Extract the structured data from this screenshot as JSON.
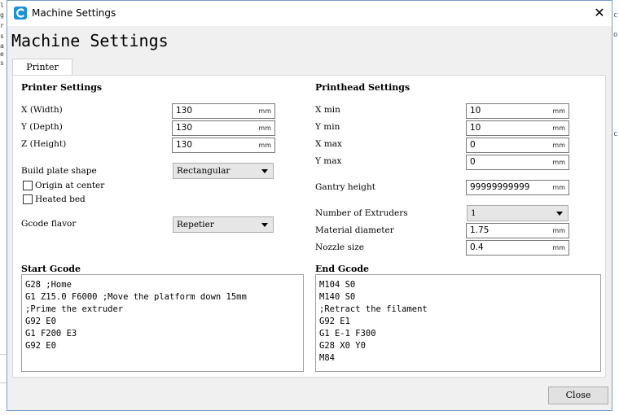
{
  "background": {
    "left_fragments": [
      "l",
      "g",
      "r",
      "s",
      "a",
      "e",
      "s"
    ],
    "right_fragments": [
      "c",
      "o",
      "c"
    ]
  },
  "window": {
    "title": "Machine Settings",
    "close_glyph": "✕",
    "heading": "Machine Settings",
    "tab": "Printer"
  },
  "printer_settings": {
    "header": "Printer Settings",
    "fields": [
      {
        "label": "X (Width)",
        "value": "130",
        "unit": "mm"
      },
      {
        "label": "Y (Depth)",
        "value": "130",
        "unit": "mm"
      },
      {
        "label": "Z (Height)",
        "value": "130",
        "unit": "mm"
      }
    ],
    "build_plate_label": "Build plate shape",
    "build_plate_value": "Rectangular",
    "origin_label": "Origin at center",
    "heated_label": "Heated bed",
    "gcode_flavor_label": "Gcode flavor",
    "gcode_flavor_value": "Repetier"
  },
  "printhead_settings": {
    "header": "Printhead Settings",
    "fields": [
      {
        "label": "X min",
        "value": "10",
        "unit": "mm"
      },
      {
        "label": "Y min",
        "value": "10",
        "unit": "mm"
      },
      {
        "label": "X max",
        "value": "0",
        "unit": "mm"
      },
      {
        "label": "Y max",
        "value": "0",
        "unit": "mm"
      }
    ],
    "gantry_label": "Gantry height",
    "gantry_value": "99999999999",
    "gantry_unit": "mm",
    "extruders_label": "Number of Extruders",
    "extruders_value": "1",
    "material_label": "Material diameter",
    "material_value": "1.75",
    "material_unit": "mm",
    "nozzle_label": "Nozzle size",
    "nozzle_value": "0.4",
    "nozzle_unit": "mm"
  },
  "start_gcode": {
    "header": "Start Gcode",
    "lines": [
      "G28 ;Home",
      "G1 Z15.0 F6000 ;Move the platform down 15mm",
      ";Prime the extruder",
      "G92 E0",
      "G1 F200 E3",
      "G92 E0"
    ]
  },
  "end_gcode": {
    "header": "End Gcode",
    "lines": [
      "M104 S0",
      "M140 S0",
      ";Retract the filament",
      "G92 E1",
      "G1 E-1 F300",
      "G28 X0 Y0",
      "M84"
    ]
  },
  "close_button": "Close"
}
